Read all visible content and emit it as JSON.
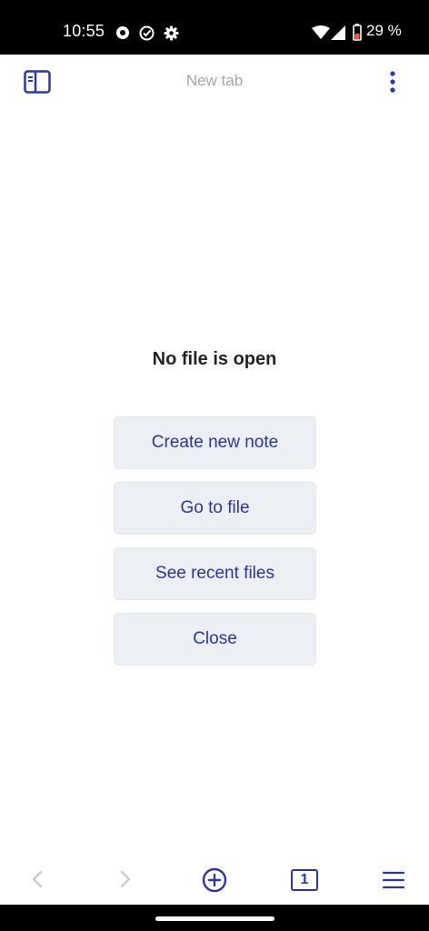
{
  "status_bar": {
    "time": "10:55",
    "battery": "29 %",
    "icons": [
      "do-not-disturb-icon",
      "check-circle-icon",
      "gear-icon",
      "wifi-icon",
      "signal-icon",
      "battery-icon"
    ]
  },
  "header": {
    "title": "New tab",
    "left_icon": "sidebar-toggle-icon",
    "right_icon": "more-vertical-icon"
  },
  "main": {
    "empty_title": "No file is open",
    "actions": [
      "Create new note",
      "Go to file",
      "See recent files",
      "Close"
    ]
  },
  "bottom_nav": {
    "tab_count": "1",
    "icons": [
      "back-icon",
      "forward-icon",
      "new-tab-icon",
      "tabs-icon",
      "menu-icon"
    ]
  },
  "colors": {
    "accent": "#2a36a5",
    "button_bg": "#eceff4",
    "muted_text": "#a0a5ad",
    "title_text": "#1f2329",
    "disabled_icon": "#c4c8ce"
  }
}
